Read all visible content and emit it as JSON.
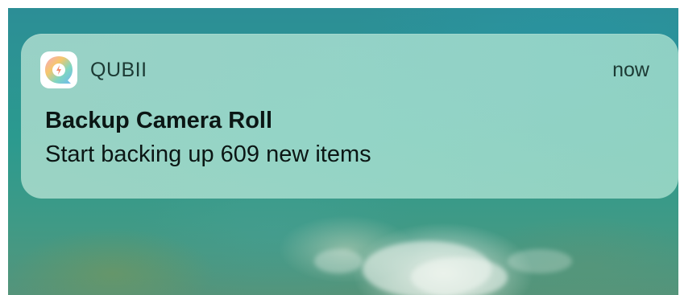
{
  "notification": {
    "app_name": "QUBII",
    "app_icon": "qubii-app-icon",
    "timestamp": "now",
    "title": "Backup Camera Roll",
    "message": "Start backing up 609 new items"
  },
  "colors": {
    "notification_background": "#b4e1d2",
    "text_primary": "#0b1614",
    "text_secondary": "#1c3a34",
    "wallpaper_ocean": "#2b9a8f"
  }
}
